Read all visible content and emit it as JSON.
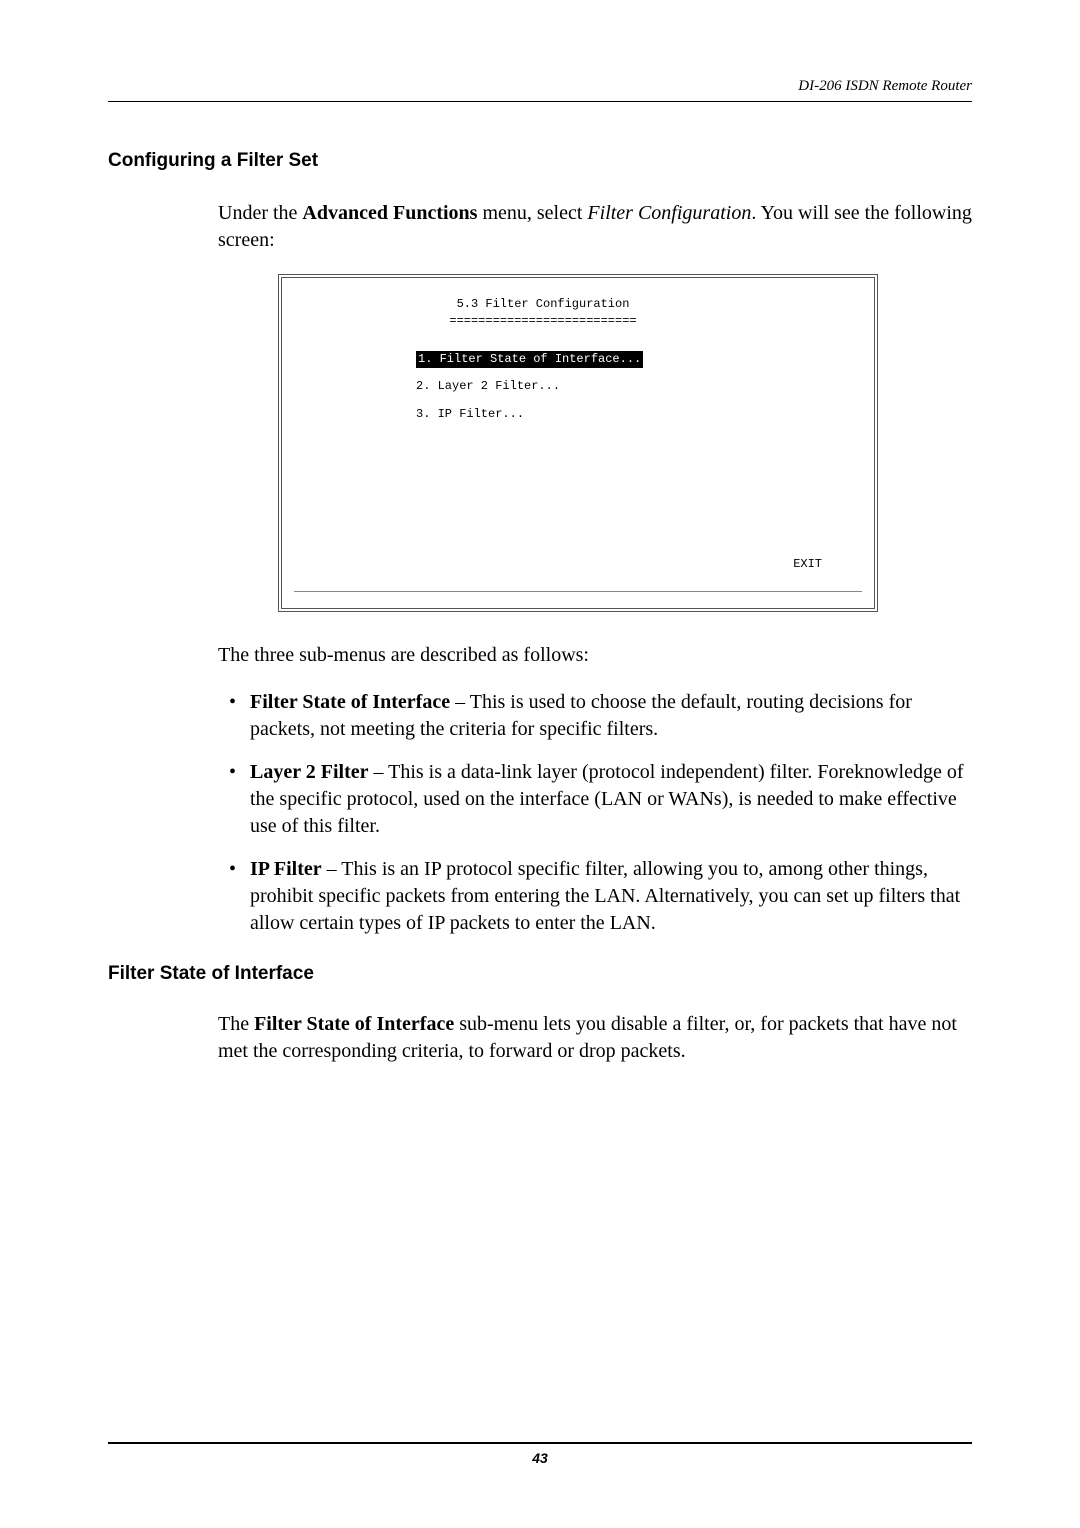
{
  "header": {
    "doc_title": "DI-206 ISDN Remote Router"
  },
  "section": {
    "heading": "Configuring a Filter Set",
    "intro_pre": "Under the ",
    "intro_bold": "Advanced Functions",
    "intro_mid": " menu, select ",
    "intro_ital": "Filter Configuration",
    "intro_post": ". You will see the following screen:"
  },
  "screenshot": {
    "title": "5.3 Filter Configuration",
    "underline": "==========================",
    "items": [
      "1. Filter State of Interface...",
      "2. Layer 2 Filter...",
      "3. IP Filter..."
    ],
    "exit": "EXIT"
  },
  "after_shot": "The three sub-menus are described as follows:",
  "bullets": [
    {
      "lead": "Filter State of Interface",
      "rest": " – This is used to choose the default, routing decisions for packets, not meeting the criteria for specific filters."
    },
    {
      "lead": "Layer 2 Filter",
      "rest": " – This is a data-link layer (protocol independent) filter. Foreknowledge of the specific protocol, used on the interface (LAN or WANs), is needed to make effective use of this filter."
    },
    {
      "lead": "IP Filter",
      "rest": " – This is an IP protocol specific filter, allowing you to, among other things, prohibit specific packets from entering the LAN. Alternatively, you can set up filters that allow certain types of IP packets to enter the LAN."
    }
  ],
  "subsection": {
    "heading": "Filter State of Interface",
    "para_pre": "The ",
    "para_bold": "Filter State of Interface",
    "para_post": " sub-menu lets you disable a filter, or, for packets that have not met the corresponding criteria, to forward or drop packets."
  },
  "footer": {
    "page": "43"
  }
}
